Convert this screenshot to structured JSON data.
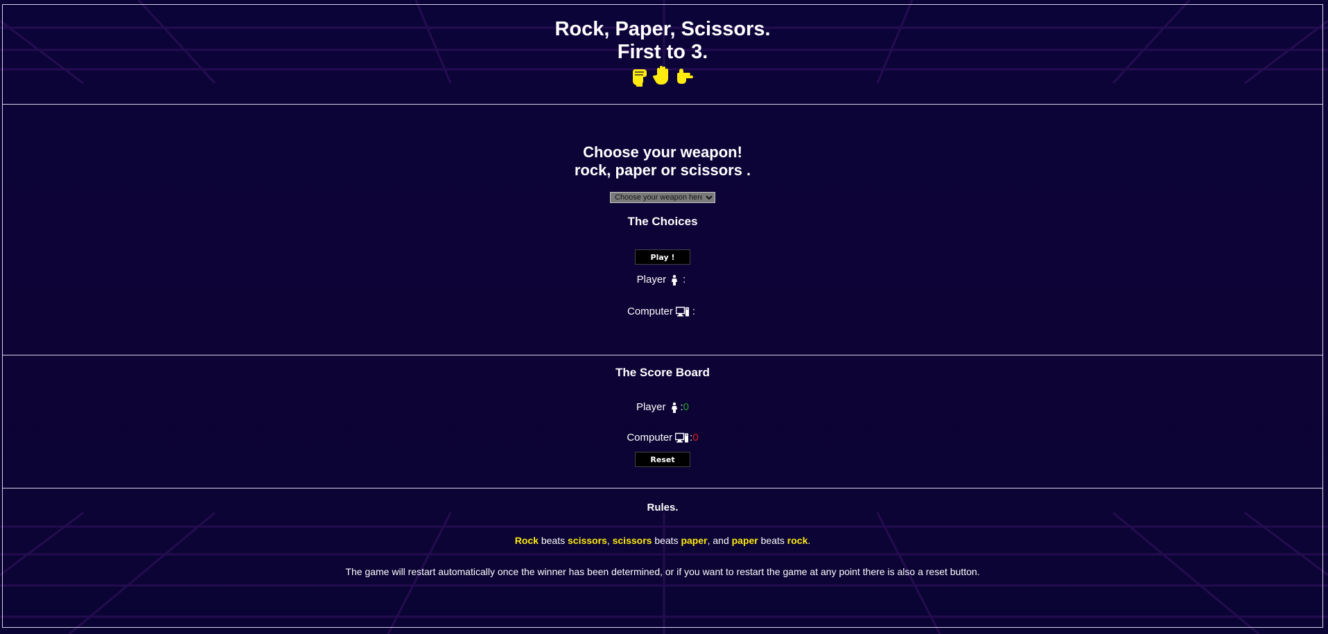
{
  "header": {
    "title_line1": "Rock, Paper, Scissors.",
    "title_line2": "First to 3.",
    "hand_icons": [
      "raised-fist",
      "raised-hand",
      "pointing-hand"
    ],
    "icon_color": "#ffeb10"
  },
  "game": {
    "prompt_line1": "Choose your weapon!",
    "prompt_line2": "rock, paper or scissors .",
    "weapon_select": {
      "selected": "Choose your weapon here!"
    },
    "choices_heading": "The Choices",
    "play_button": "Play !",
    "player_label": "Player",
    "player_icon": "person-icon",
    "player_choice": "",
    "computer_label": "Computer",
    "computer_icon": "computer-icon",
    "computer_choice": "",
    "separator": ":"
  },
  "scoreboard": {
    "heading": "The Score Board",
    "player_label": "Player",
    "player_score": "0",
    "player_score_color": "#1fa12a",
    "computer_label": "Computer",
    "computer_score": "0",
    "computer_score_color": "#e01b1b",
    "separator": ":",
    "reset_button": "Reset"
  },
  "rules": {
    "heading": "Rules.",
    "rule_parts": {
      "rock_cap": "Rock",
      "beats1": " beats ",
      "scissors1": "scissors",
      "comma1": ", ",
      "scissors2": "scissors",
      "beats2": " beats ",
      "paper1": "paper",
      "and": ", and ",
      "paper2": "paper",
      "beats3": " beats ",
      "rock": "rock",
      "period": "."
    },
    "restart_note": "The game will restart automatically once the winner has been determined, or if you want to restart the game at any point there is also a reset button."
  },
  "colors": {
    "background": "#0a0434",
    "highlight": "#ffeb10",
    "border": "#d8d4e8"
  }
}
